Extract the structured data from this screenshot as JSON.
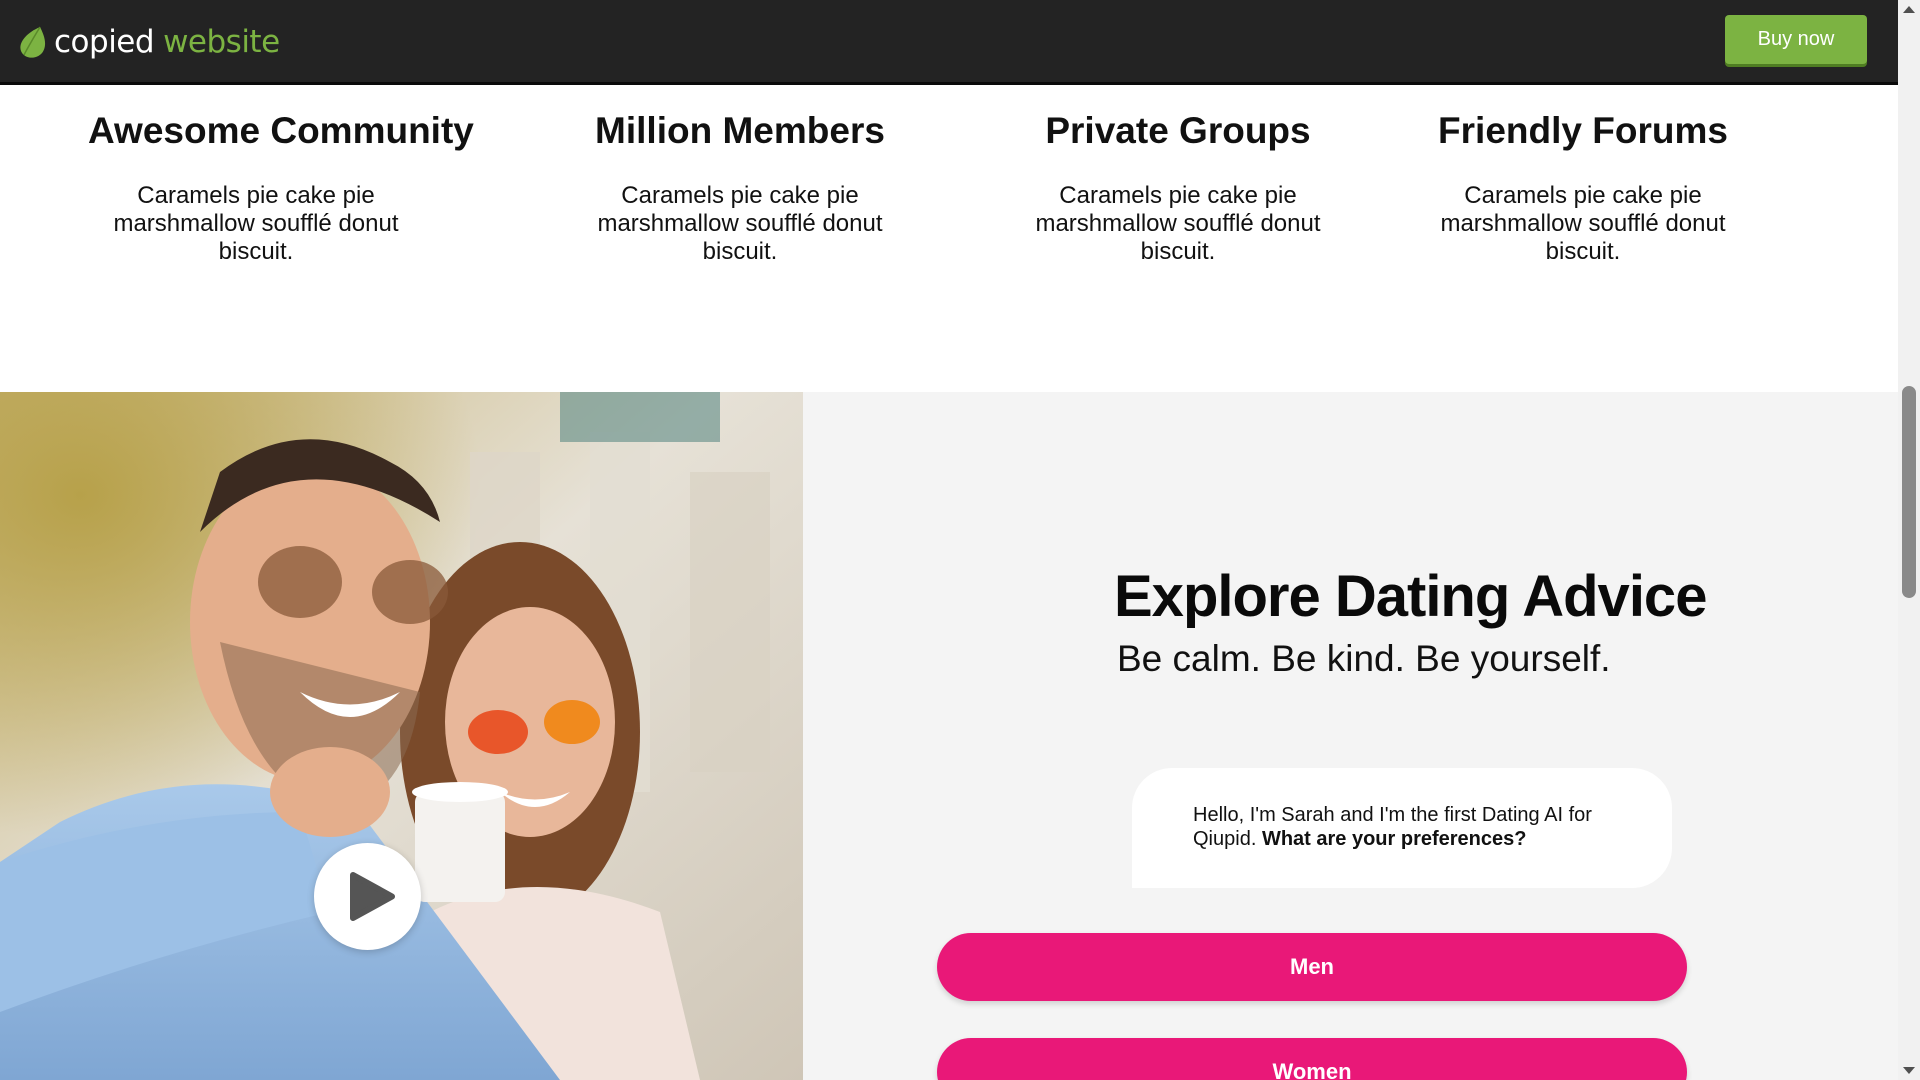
{
  "header": {
    "brand_part1": "copied",
    "brand_part2": "website",
    "buy_label": "Buy now",
    "accent_color": "#7cb342"
  },
  "features": [
    {
      "title": "Awesome Community",
      "text": "Caramels pie cake pie marshmallow soufflé donut biscuit."
    },
    {
      "title": "Million Members",
      "text": "Caramels pie cake pie marshmallow soufflé donut biscuit."
    },
    {
      "title": "Private Groups",
      "text": "Caramels pie cake pie marshmallow soufflé donut biscuit."
    },
    {
      "title": "Friendly Forums",
      "text": "Caramels pie cake pie marshmallow soufflé donut biscuit."
    }
  ],
  "dating": {
    "title": "Explore Dating Advice",
    "subtitle": "Be calm. Be kind. Be yourself.",
    "chat_text": "Hello, I'm Sarah and I'm the first Dating AI for Qiupid.",
    "chat_question": "What are your preferences?",
    "options": [
      "Men",
      "Women"
    ],
    "button_color": "#e91878",
    "play_icon": "play-icon"
  }
}
